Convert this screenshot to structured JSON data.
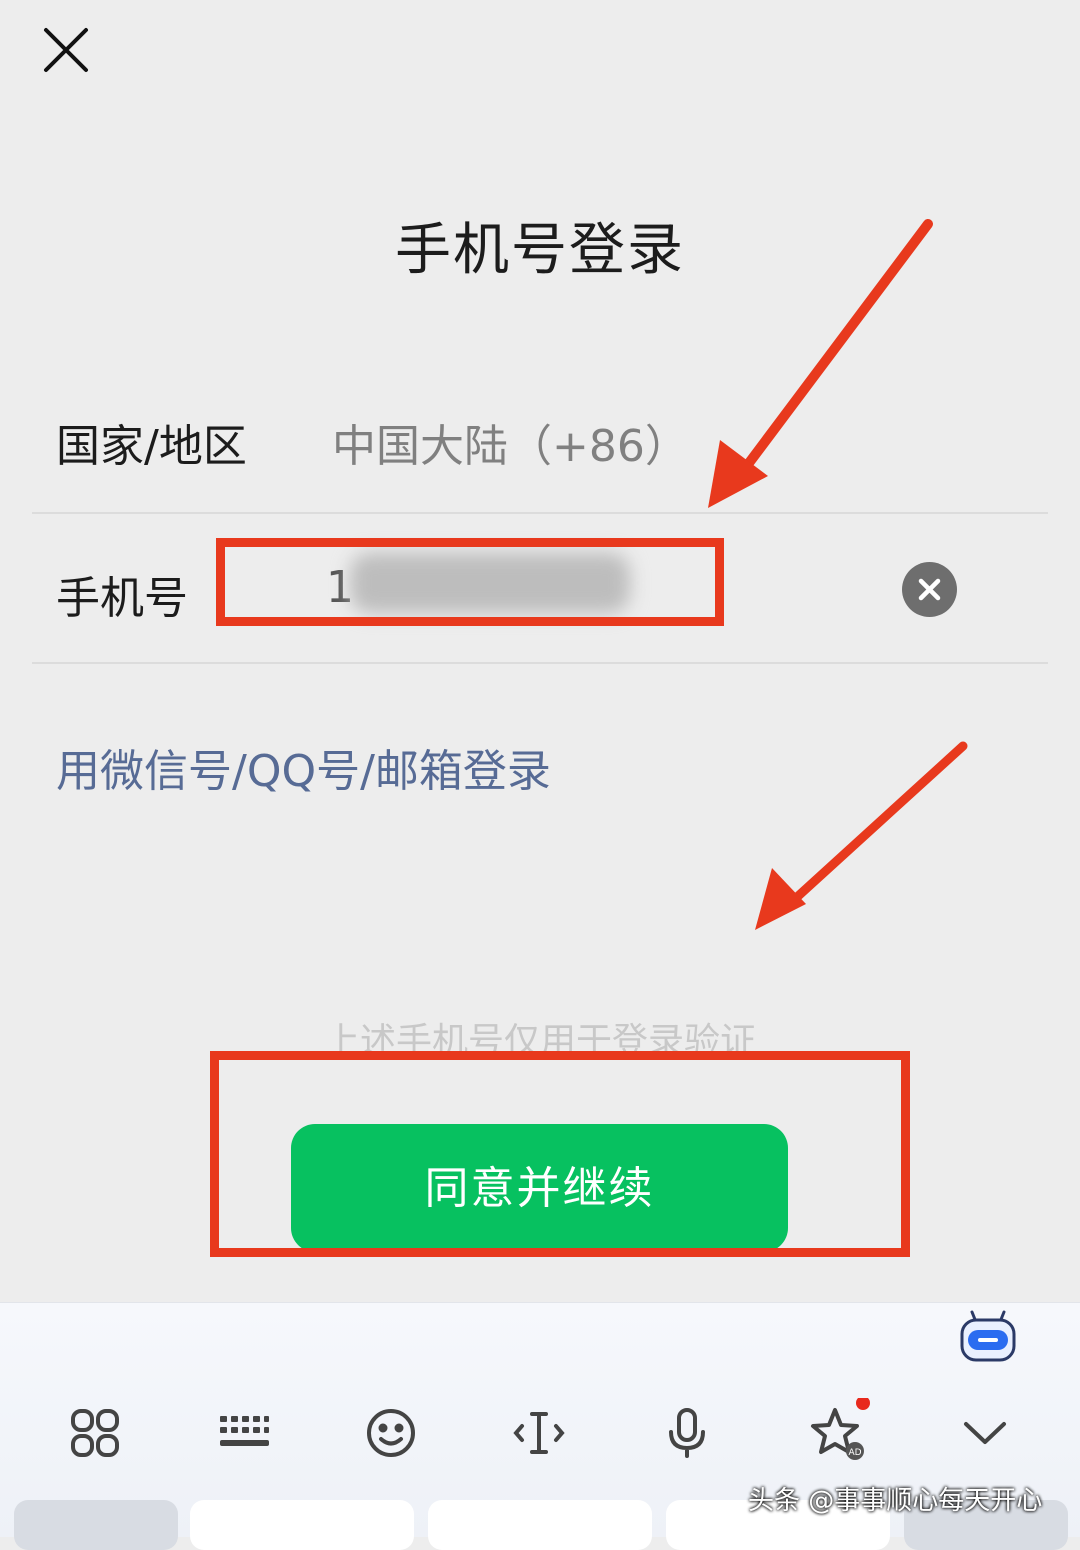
{
  "header": {
    "title": "手机号登录"
  },
  "form": {
    "country_label": "国家/地区",
    "country_value": "中国大陆（+86）",
    "phone_label": "手机号",
    "phone_value": "1"
  },
  "alt_login_link": "用微信号/QQ号/邮箱登录",
  "notice": "上述手机号仅用于登录验证",
  "primary_button": "同意并继续",
  "keyboard_toolbar": {
    "icons": [
      "apps-grid-icon",
      "keyboard-icon",
      "emoji-icon",
      "cursor-icon",
      "microphone-icon",
      "star-ad-icon",
      "chevron-down-icon"
    ],
    "assistant_icon": "robot-assistant-icon"
  },
  "watermark": "头条 @事事顺心每天开心",
  "colors": {
    "accent_green": "#07c160",
    "link_blue": "#576b95",
    "annotation_red": "#e8391d"
  }
}
